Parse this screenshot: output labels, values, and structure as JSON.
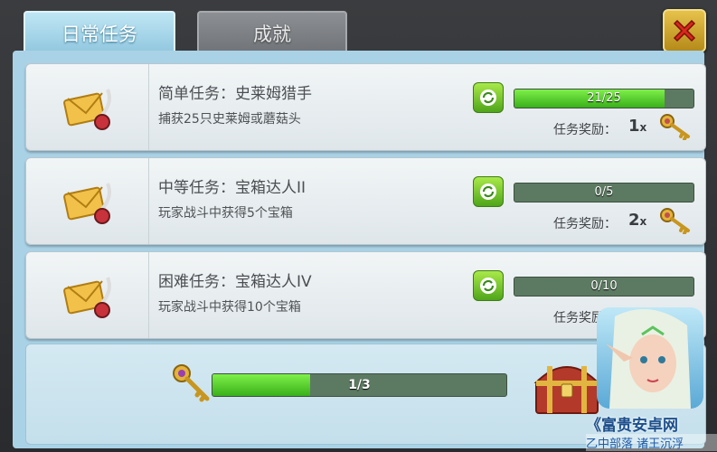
{
  "tabs": [
    {
      "label": "日常任务",
      "active": true
    },
    {
      "label": "成就",
      "active": false
    }
  ],
  "close_icon": "close-x-icon",
  "tasks": [
    {
      "title": "简单任务：史莱姆猎手",
      "desc": "捕获25只史莱姆或蘑菇头",
      "progress_text": "21/25",
      "progress": 0.84,
      "reward_label": "任务奖励：",
      "reward_count": "1",
      "reward_x": "x"
    },
    {
      "title": "中等任务：宝箱达人II",
      "desc": "玩家战斗中获得5个宝箱",
      "progress_text": "0/5",
      "progress": 0,
      "reward_label": "任务奖励：",
      "reward_count": "2",
      "reward_x": "x"
    },
    {
      "title": "困难任务：宝箱达人IV",
      "desc": "玩家战斗中获得10个宝箱",
      "progress_text": "0/10",
      "progress": 0,
      "reward_label": "任务奖励：",
      "reward_count": "",
      "reward_x": ""
    }
  ],
  "summary": {
    "progress_text": "1/3",
    "progress": 0.333
  },
  "watermark": {
    "title": "《富贵安卓网",
    "sub": "乙中部落 诸王沉浮"
  },
  "colors": {
    "accent_green": "#39b01a",
    "tab_active": "#9fd2e8",
    "gold": "#d4a52a"
  }
}
